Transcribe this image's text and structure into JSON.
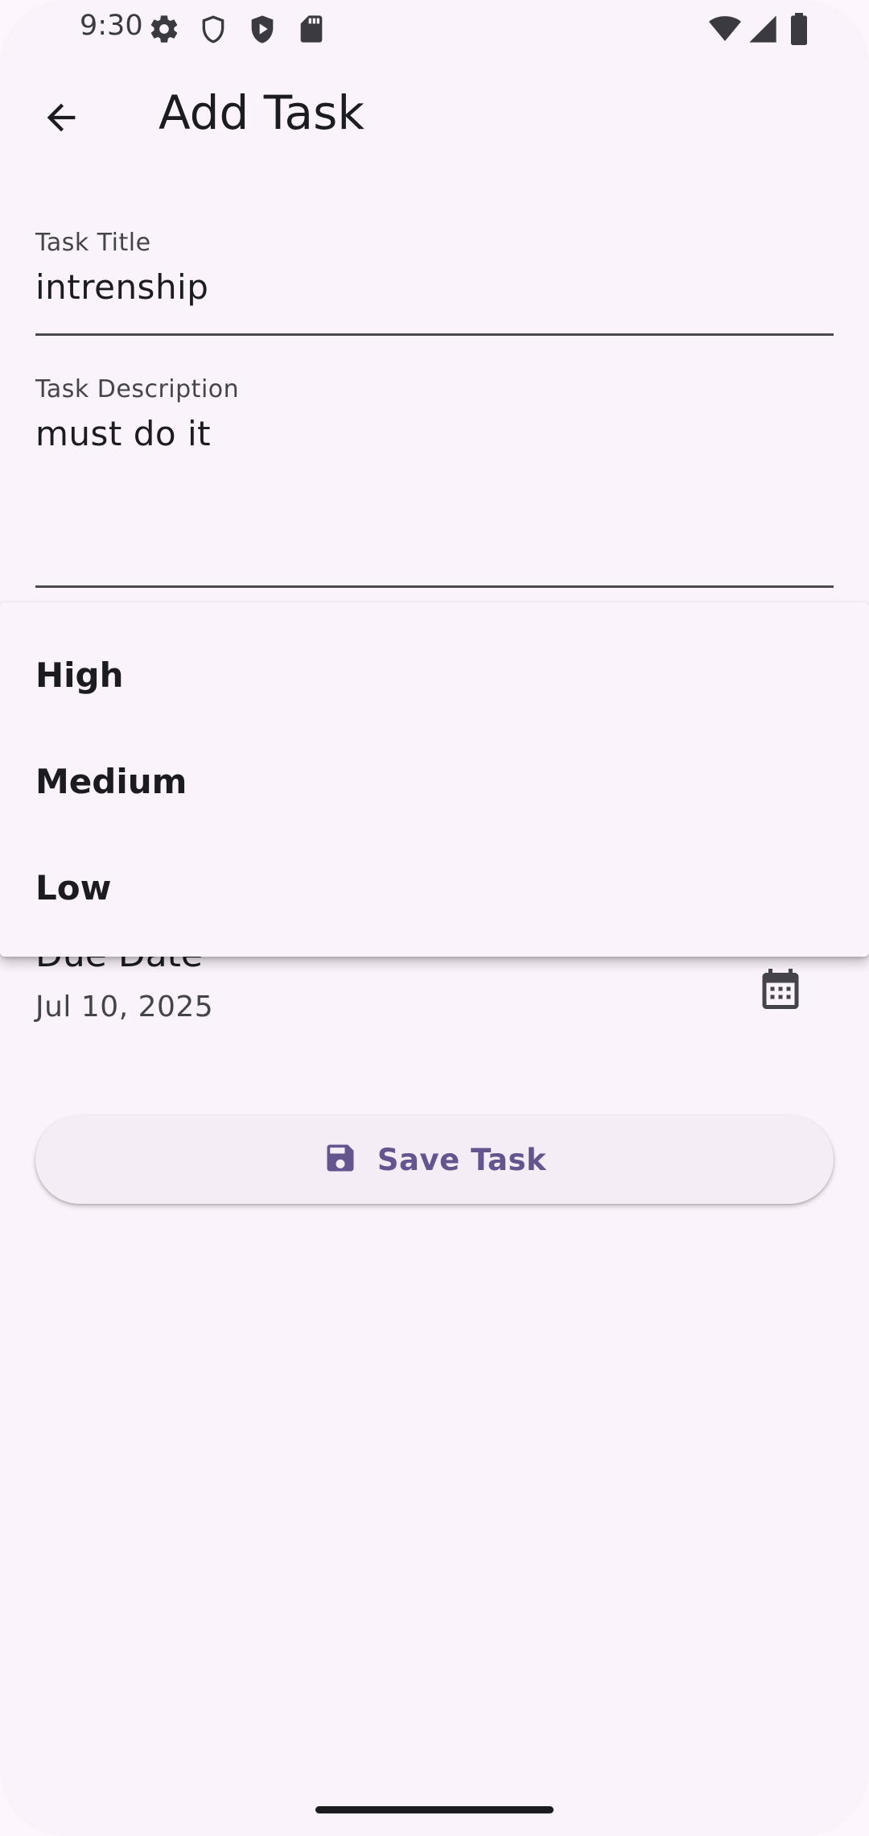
{
  "status_bar": {
    "time": "9:30",
    "icons_left": [
      "settings-icon",
      "shield-icon",
      "play-protect-icon",
      "sd-card-icon"
    ],
    "icons_right": [
      "wifi-icon",
      "signal-icon",
      "battery-icon"
    ]
  },
  "app_bar": {
    "title": "Add Task",
    "back_icon": "arrow-back-icon"
  },
  "form": {
    "title_field": {
      "label": "Task Title",
      "value": "intrenship"
    },
    "description_field": {
      "label": "Task Description",
      "value": "must do it"
    },
    "due_date": {
      "label": "Due Date",
      "value": "Jul 10, 2025",
      "icon": "calendar-icon"
    },
    "save_button": {
      "label": "Save Task",
      "icon": "save-icon"
    }
  },
  "priority_menu": {
    "items": [
      {
        "label": "High"
      },
      {
        "label": "Medium"
      },
      {
        "label": "Low"
      }
    ]
  },
  "colors": {
    "background": "#fbf3fb",
    "primary": "#65558f",
    "on_surface": "#1c1b20",
    "on_surface_variant": "#45444b"
  }
}
